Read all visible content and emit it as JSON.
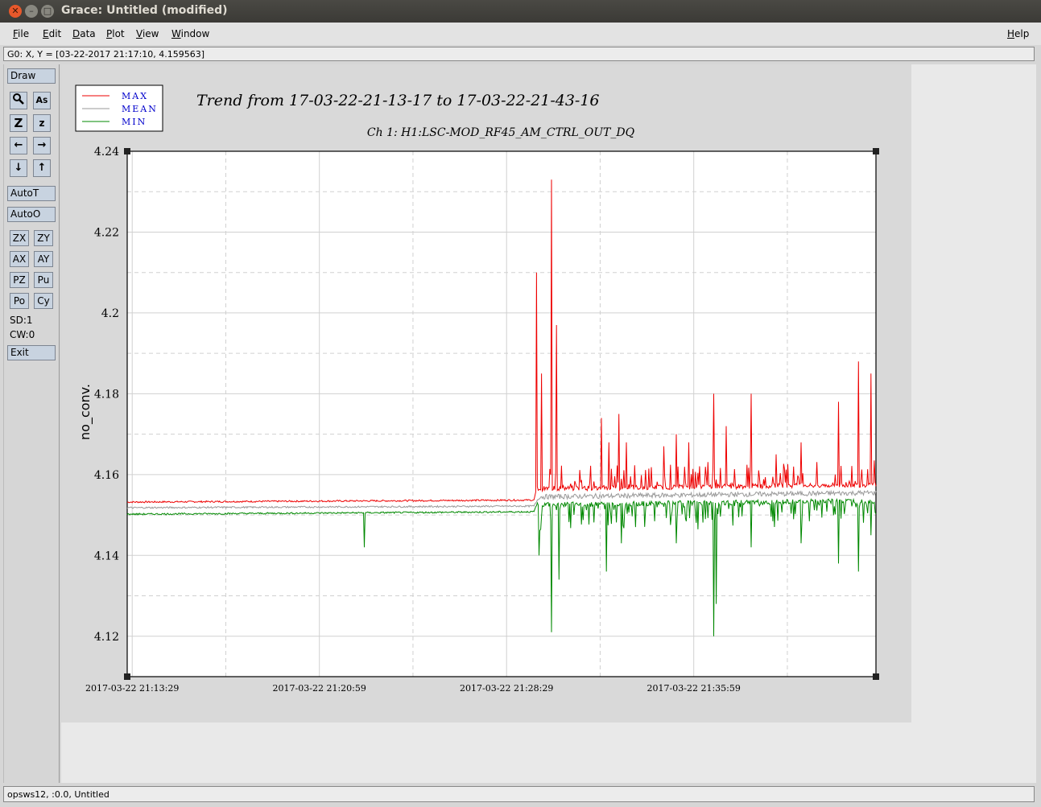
{
  "window": {
    "title": "Grace: Untitled (modified)"
  },
  "menu": {
    "file": "File",
    "edit": "Edit",
    "data": "Data",
    "plot": "Plot",
    "view": "View",
    "window": "Window",
    "help": "Help"
  },
  "coord_readout": "G0: X, Y = [03-22-2017 21:17:10, 4.159563]",
  "toolbar": {
    "draw": "Draw",
    "autot": "AutoT",
    "autoo": "AutoO",
    "zx": "ZX",
    "zy": "ZY",
    "ax": "AX",
    "ay": "AY",
    "pz": "PZ",
    "pu": "Pu",
    "po": "Po",
    "cy": "Cy",
    "sd": "SD:1",
    "cw": "CW:0",
    "exit": "Exit"
  },
  "status": "opsws12, :0.0, Untitled",
  "colors": {
    "max": "#ee0000",
    "mean": "#999999",
    "min": "#008800"
  },
  "chart_data": {
    "type": "line",
    "title": "Trend from 17-03-22-21-13-17 to 17-03-22-21-43-16",
    "subtitle": "Ch 1: H1:LSC-MOD_RF45_AM_CTRL_OUT_DQ",
    "xlabel": "",
    "ylabel": "no_conv.",
    "x_ticks": [
      "2017-03-22 21:13:29",
      "2017-03-22 21:20:59",
      "2017-03-22 21:28:29",
      "2017-03-22 21:35:59"
    ],
    "y_ticks": [
      "4.12",
      "4.14",
      "4.16",
      "4.18",
      "4.2",
      "4.22",
      "4.24"
    ],
    "ylim": [
      4.11,
      4.24
    ],
    "xlim_minutes": [
      0,
      30
    ],
    "legend": [
      "MAX",
      "MEAN",
      "MIN"
    ],
    "legend_position": "top-left",
    "grid": true,
    "series": [
      {
        "name": "MAX",
        "color": "#ee0000",
        "baseline": [
          [
            0,
            4.1532
          ],
          [
            16.3,
            4.1537
          ],
          [
            16.4,
            4.1565
          ],
          [
            30,
            4.1575
          ]
        ],
        "spikes": [
          [
            16.4,
            4.21
          ],
          [
            16.6,
            4.185
          ],
          [
            17.0,
            4.233
          ],
          [
            17.2,
            4.197
          ],
          [
            19.0,
            4.174
          ],
          [
            19.3,
            4.168
          ],
          [
            19.7,
            4.175
          ],
          [
            20.0,
            4.168
          ],
          [
            21.5,
            4.167
          ],
          [
            22.0,
            4.17
          ],
          [
            22.5,
            4.168
          ],
          [
            23.5,
            4.18
          ],
          [
            24.0,
            4.172
          ],
          [
            25.0,
            4.18
          ],
          [
            26.0,
            4.165
          ],
          [
            27.0,
            4.168
          ],
          [
            28.5,
            4.178
          ],
          [
            29.3,
            4.188
          ],
          [
            29.8,
            4.185
          ]
        ]
      },
      {
        "name": "MEAN",
        "color": "#999999",
        "baseline": [
          [
            0,
            4.1518
          ],
          [
            16.3,
            4.1522
          ],
          [
            16.5,
            4.1545
          ],
          [
            30,
            4.1555
          ]
        ],
        "spikes": []
      },
      {
        "name": "MIN",
        "color": "#008800",
        "baseline": [
          [
            0,
            4.1502
          ],
          [
            16.3,
            4.1508
          ],
          [
            16.4,
            4.1525
          ],
          [
            30,
            4.1535
          ]
        ],
        "spikes": [
          [
            9.5,
            4.142
          ],
          [
            16.5,
            4.14
          ],
          [
            17.0,
            4.121
          ],
          [
            17.3,
            4.134
          ],
          [
            19.2,
            4.136
          ],
          [
            19.8,
            4.143
          ],
          [
            22.0,
            4.143
          ],
          [
            23.6,
            4.128
          ],
          [
            23.5,
            4.12
          ],
          [
            25.0,
            4.142
          ],
          [
            27.0,
            4.143
          ],
          [
            28.5,
            4.138
          ],
          [
            29.3,
            4.136
          ],
          [
            29.8,
            4.145
          ]
        ]
      }
    ]
  }
}
